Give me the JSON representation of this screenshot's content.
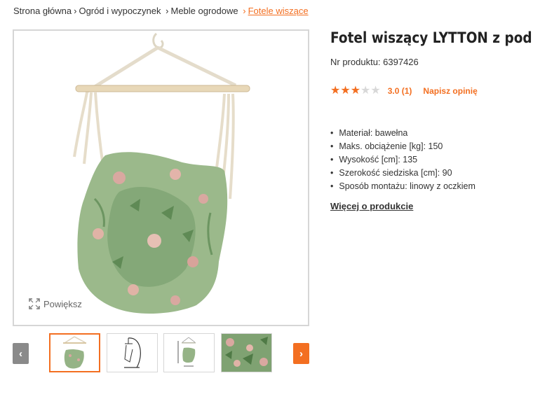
{
  "breadcrumb": {
    "items": [
      "Strona główna",
      "Ogród i wypoczynek",
      "Meble ogrodowe",
      "Fotele wiszące"
    ],
    "separator": "›"
  },
  "gallery": {
    "zoom_label": "Powiększ",
    "prev_label": "‹",
    "next_label": "›",
    "thumbnail_count": 4,
    "active_thumbnail": 1
  },
  "product": {
    "title": "Fotel wiszący LYTTON z poduszką",
    "product_number": "Nr produktu: 6397426",
    "rating_value": 3,
    "rating_max": 5,
    "rating_text": "3.0 (1)",
    "review_link": "Napisz opinię",
    "specs": [
      "Materiał: bawełna",
      "Maks. obciążenie [kg]: 150",
      "Wysokość [cm]: 135",
      "Szerokość siedziska [cm]: 90",
      "Sposób montażu: linowy z oczkiem"
    ],
    "more_link": "Więcej o produkcie"
  },
  "colors": {
    "accent": "#f36f21",
    "nav_disabled": "#8a8a8a",
    "border": "#d6d6d6"
  }
}
